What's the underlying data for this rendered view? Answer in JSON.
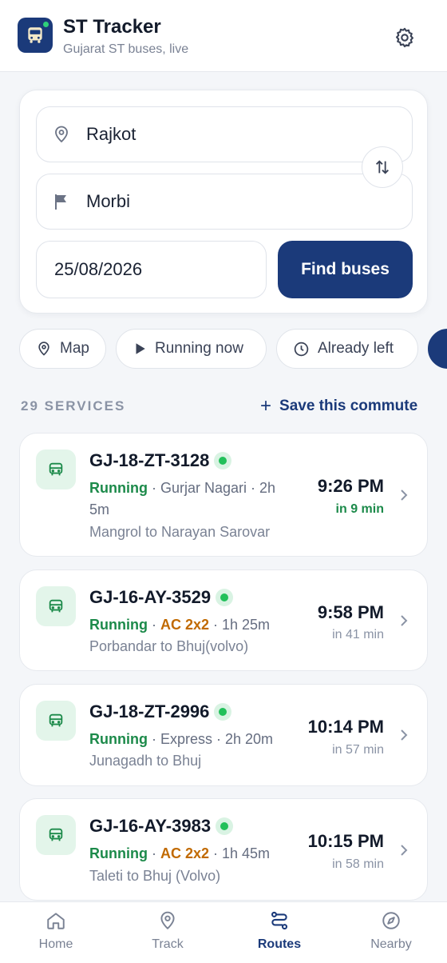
{
  "header": {
    "title": "ST Tracker",
    "subtitle": "Gujarat ST buses, live"
  },
  "search": {
    "from": "Rajkot",
    "to": "Morbi",
    "date": "25/08/2026",
    "find_label": "Find buses"
  },
  "chips": [
    {
      "label": "Map",
      "icon": "map-pin-icon"
    },
    {
      "label": "Running now",
      "icon": "play-icon"
    },
    {
      "label": "Already left",
      "icon": "clock-icon"
    }
  ],
  "services": {
    "count_label": "29 SERVICES",
    "save_label": "Save this commute"
  },
  "buses": [
    {
      "reg": "GJ-18-ZT-3128",
      "status": "Running",
      "type": "Gurjar Nagari",
      "duration": "2h 5m",
      "route": "Mangrol to Narayan Sarovar",
      "time": "9:26 PM",
      "eta": "in 9 min"
    },
    {
      "reg": "GJ-16-AY-3529",
      "status": "Running",
      "type": "AC 2x2",
      "duration": "1h 25m",
      "route": "Porbandar to Bhuj(volvo)",
      "time": "9:58 PM",
      "eta": "in 41 min"
    },
    {
      "reg": "GJ-18-ZT-2996",
      "status": "Running",
      "type": "Express",
      "duration": "2h 20m",
      "route": "Junagadh to Bhuj",
      "time": "10:14 PM",
      "eta": "in 57 min"
    },
    {
      "reg": "GJ-16-AY-3983",
      "status": "Running",
      "type": "AC 2x2",
      "duration": "1h 45m",
      "route": "Taleti to Bhuj (Volvo)",
      "time": "10:15 PM",
      "eta": "in 58 min"
    }
  ],
  "nav": {
    "home": "Home",
    "track": "Track",
    "routes": "Routes",
    "nearby": "Nearby",
    "active": "Routes"
  },
  "colors": {
    "primary": "#1b3a7a",
    "running": "#1c8a4a",
    "ac": "#c16a00",
    "live_dot": "#22c05a"
  }
}
